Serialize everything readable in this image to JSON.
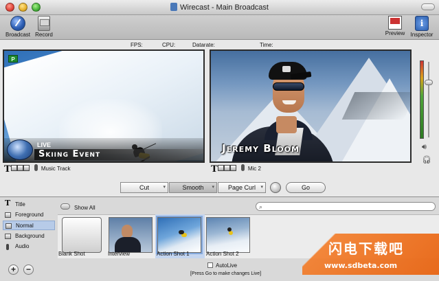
{
  "window": {
    "title": "Wirecast - Main Broadcast"
  },
  "toolbar": {
    "broadcast_label": "Broadcast",
    "record_label": "Record",
    "preview_label": "Preview",
    "inspector_label": "Inspector"
  },
  "stats": {
    "fps_label": "FPS:",
    "cpu_label": "CPU:",
    "datarate_label": "Datarate:",
    "time_label": "Time:"
  },
  "preview": {
    "badge": "P",
    "live_tag": "LIVE",
    "event_title": "Skiing Event",
    "audio_label": "Music Track"
  },
  "live": {
    "lower_third": "Jeremy Bloom",
    "audio_label": "Mic 2"
  },
  "transitions": {
    "cut_label": "Cut",
    "smooth_label": "Smooth",
    "page_curl_label": "Page Curl",
    "go_label": "Go"
  },
  "layers": [
    {
      "label": "Title",
      "icon": "title-icon"
    },
    {
      "label": "Foreground",
      "icon": "layer-icon"
    },
    {
      "label": "Normal",
      "icon": "layer-icon"
    },
    {
      "label": "Background",
      "icon": "layer-icon"
    },
    {
      "label": "Audio",
      "icon": "audio-icon"
    }
  ],
  "shots": {
    "show_all_label": "Show All",
    "search_placeholder": "",
    "items": [
      {
        "label": "Blank Shot"
      },
      {
        "label": "Interview"
      },
      {
        "label": "Action Shot 1"
      },
      {
        "label": "Action Shot 2"
      }
    ]
  },
  "bottom": {
    "add_label": "+",
    "remove_label": "−",
    "autolive_label": "AutoLive",
    "autolive_note": "[Press Go to make changes Live]"
  },
  "watermark": {
    "cn_text": "闪电下载吧",
    "url": "www.sdbeta.com"
  },
  "colors": {
    "accent": "#84a9dd",
    "preview_badge": "#1e8a2e",
    "watermark": "#e86412"
  }
}
